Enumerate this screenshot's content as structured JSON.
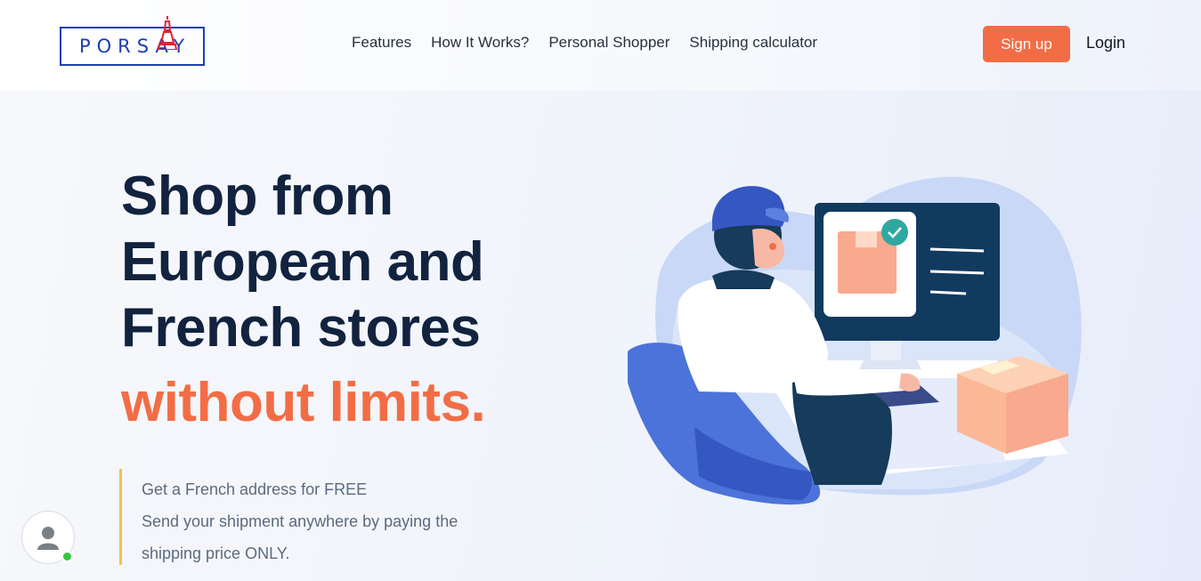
{
  "brand": {
    "logo_text": "PORSAY"
  },
  "nav": {
    "items": [
      {
        "label": "Features"
      },
      {
        "label": "How It Works?"
      },
      {
        "label": "Personal Shopper"
      },
      {
        "label": "Shipping calculator"
      }
    ],
    "signup_label": "Sign up",
    "login_label": "Login"
  },
  "hero": {
    "line1": "Shop from",
    "line2": "European and",
    "line3": "French stores",
    "accent": "without limits.",
    "sub1": "Get a French address for FREE",
    "sub2": "Send your shipment anywhere by paying the",
    "sub3": "shipping price ONLY."
  },
  "colors": {
    "accent": "#f26d45",
    "brand_blue": "#1d3fb0",
    "heading": "#12233f",
    "quote_bar": "#f5c04a",
    "online": "#35c73e"
  },
  "icons": [
    "eiffel-tower-icon",
    "user-avatar-icon",
    "online-status-icon",
    "checkmark-icon"
  ]
}
